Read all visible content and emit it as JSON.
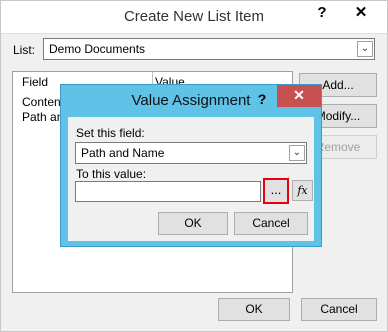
{
  "outer": {
    "title": "Create New List Item",
    "help_glyph": "?",
    "close_glyph": "✕",
    "list_label": "List:",
    "list_value": "Demo Documents",
    "columns": [
      "Field",
      "Value"
    ],
    "rows": [
      {
        "field": "Conten"
      },
      {
        "field": "Path an"
      }
    ],
    "add_label": "Add...",
    "modify_label": "Modify...",
    "remove_label": "Remove",
    "ok_label": "OK",
    "cancel_label": "Cancel"
  },
  "dialog": {
    "title": "Value Assignment",
    "help_glyph": "?",
    "close_glyph": "✕",
    "set_field_label": "Set this field:",
    "field_value": "Path and Name",
    "value_label": "To this value:",
    "value_input": "",
    "browse_label": "...",
    "formula_label": "fx",
    "ok_label": "OK",
    "cancel_label": "Cancel"
  },
  "arrow_glyph": "⌄",
  "colors": {
    "dialog_chrome": "#5fc3e8",
    "close_button": "#c75050",
    "highlight": "#e8000d"
  }
}
